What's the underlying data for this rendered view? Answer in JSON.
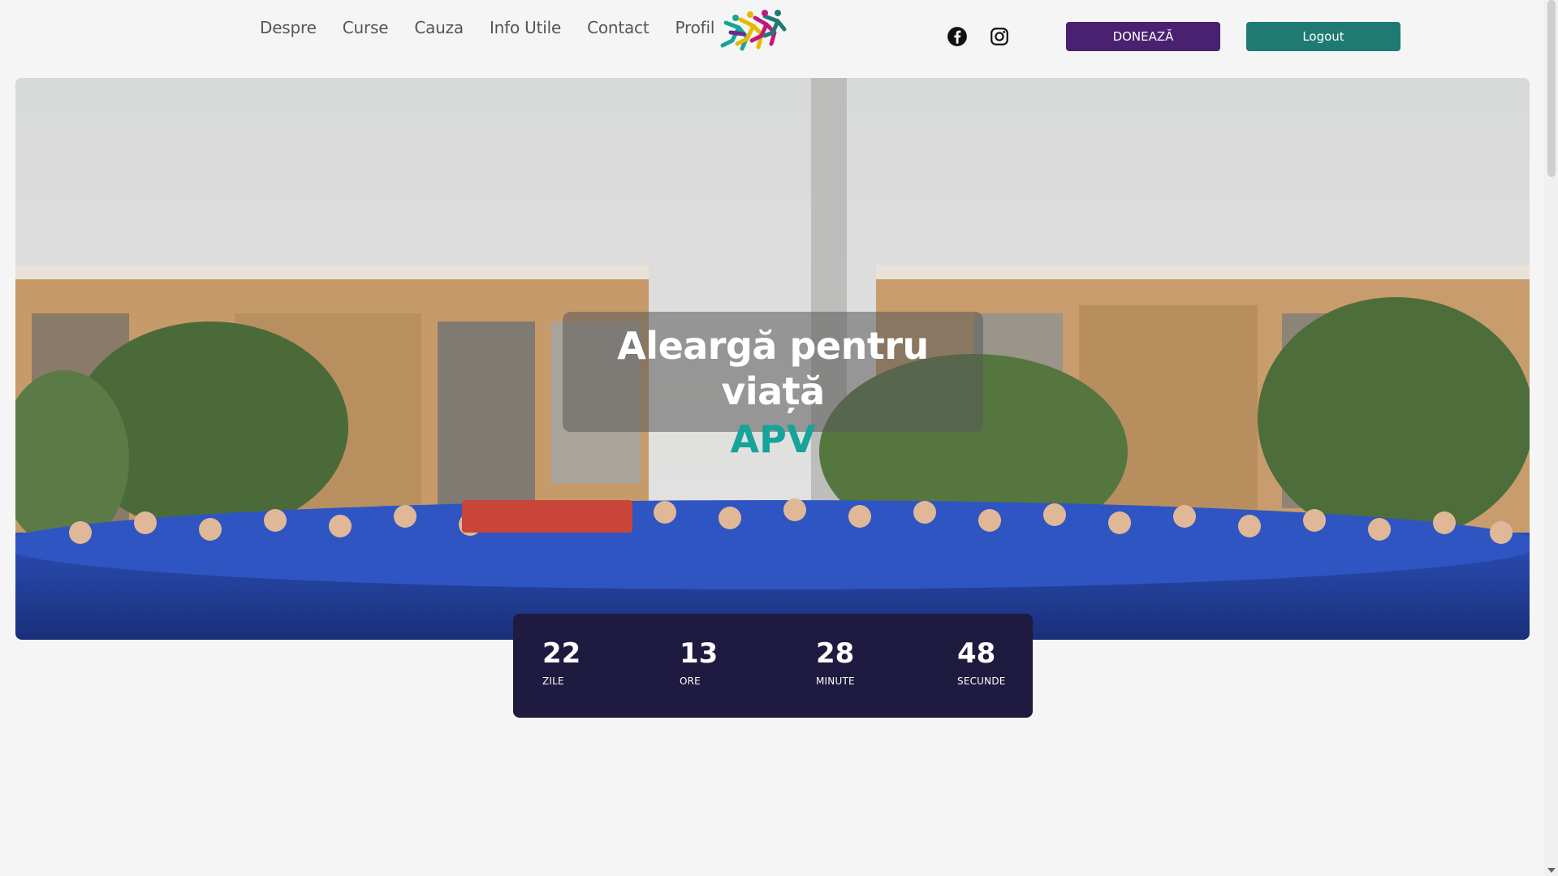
{
  "nav": {
    "items": [
      {
        "label": "Despre"
      },
      {
        "label": "Curse"
      },
      {
        "label": "Cauza"
      },
      {
        "label": "Info Utile"
      },
      {
        "label": "Contact"
      },
      {
        "label": "Profil"
      }
    ]
  },
  "header": {
    "logo_icon": "running-figures-logo-icon",
    "social": [
      {
        "icon": "facebook-icon"
      },
      {
        "icon": "instagram-icon"
      }
    ],
    "donate_label": "DONEAZĂ",
    "logout_label": "Logout"
  },
  "hero": {
    "title": "Aleargă pentru viață",
    "subtitle": "APV"
  },
  "countdown": {
    "days": {
      "value": "22",
      "label": "ZILE"
    },
    "hours": {
      "value": "13",
      "label": "ORE"
    },
    "minutes": {
      "value": "28",
      "label": "MINUTE"
    },
    "seconds": {
      "value": "48",
      "label": "SECUNDE"
    }
  },
  "colors": {
    "donate": "#4a2170",
    "logout": "#1f7a74",
    "countdown_bg": "#1e1a40",
    "accent_teal": "#16a39a"
  }
}
